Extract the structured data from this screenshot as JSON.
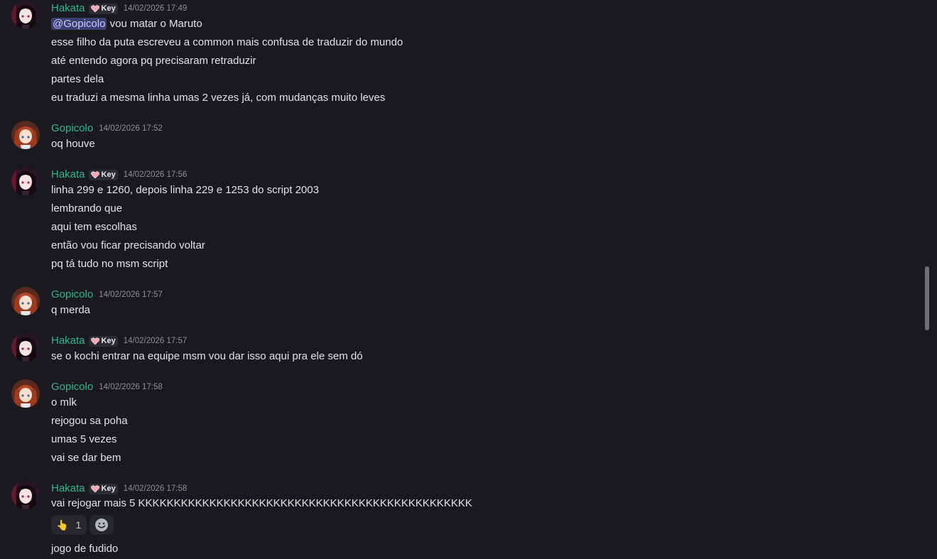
{
  "tag_label": "Key",
  "messages": [
    {
      "author": "Hakata",
      "timestamp": "14/02/2026 17:49",
      "mention": "@Gopicolo",
      "lines": [
        "vou matar o Maruto",
        "esse filho da puta escreveu a common mais confusa de traduzir do mundo",
        "até entendo agora pq precisaram retraduzir",
        "partes dela",
        "eu traduzi a mesma linha umas 2 vezes já, com mudanças muito leves"
      ]
    },
    {
      "author": "Gopicolo",
      "timestamp": "14/02/2026 17:52",
      "lines": [
        "oq houve"
      ]
    },
    {
      "author": "Hakata",
      "timestamp": "14/02/2026 17:56",
      "lines": [
        "linha 299 e 1260, depois linha 229 e 1253 do script 2003",
        "lembrando que",
        "aqui tem escolhas",
        "então vou ficar precisando voltar",
        "pq tá tudo no msm script"
      ]
    },
    {
      "author": "Gopicolo",
      "timestamp": "14/02/2026 17:57",
      "lines": [
        "q merda"
      ]
    },
    {
      "author": "Hakata",
      "timestamp": "14/02/2026 17:57",
      "lines": [
        "se o kochi entrar na equipe msm vou dar isso aqui pra ele sem dó"
      ]
    },
    {
      "author": "Gopicolo",
      "timestamp": "14/02/2026 17:58",
      "lines": [
        "o mlk",
        "rejogou sa poha",
        "umas 5 vezes",
        "vai se dar bem"
      ]
    },
    {
      "author": "Hakata",
      "timestamp": "14/02/2026 17:58",
      "lines": [
        "vai rejogar mais 5 KKKKKKKKKKKKKKKKKKKKKKKKKKKKKKKKKKKKKKKKKKKKKKK"
      ],
      "reaction": {
        "emoji": "👆",
        "count": "1"
      },
      "after_lines": [
        "jogo de fudido"
      ]
    }
  ],
  "icons": {
    "tag_icon": "heart-icon",
    "add_reaction_icon": "smiley-icon",
    "hakata_avatar": "dark-haired-anime-girl",
    "gopicolo_avatar": "red-haired-anime-girl"
  },
  "colors": {
    "background": "#1a1a1e",
    "username": "#2fb594",
    "mention_bg": "#3b3f74",
    "text": "#e1e3e6"
  }
}
